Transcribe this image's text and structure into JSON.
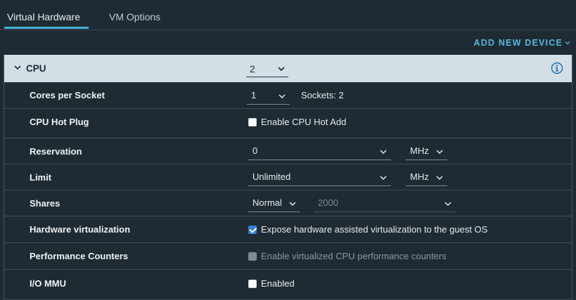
{
  "tabs": [
    {
      "label": "Virtual Hardware",
      "active": true
    },
    {
      "label": "VM Options",
      "active": false
    }
  ],
  "toolbar": {
    "add_device_label": "ADD NEW DEVICE"
  },
  "cpu": {
    "title": "CPU",
    "value": "2",
    "info_icon": "info-circle-icon",
    "rows": {
      "cores": {
        "label": "Cores per Socket",
        "value": "1",
        "sockets_text": "Sockets: 2"
      },
      "hotplug": {
        "label": "CPU Hot Plug",
        "checkbox_label": "Enable CPU Hot Add",
        "checked": false
      },
      "reservation": {
        "label": "Reservation",
        "value": "0",
        "unit": "MHz"
      },
      "limit": {
        "label": "Limit",
        "value": "Unlimited",
        "unit": "MHz"
      },
      "shares": {
        "label": "Shares",
        "level": "Normal",
        "value": "2000"
      },
      "hwvirt": {
        "label": "Hardware virtualization",
        "checkbox_label": "Expose hardware assisted virtualization to the guest OS",
        "checked": true
      },
      "perfcounters": {
        "label": "Performance Counters",
        "checkbox_label": "Enable virtualized CPU performance counters",
        "checked": false,
        "disabled": true
      },
      "iommu": {
        "label": "I/O MMU",
        "checkbox_label": "Enabled",
        "checked": false
      }
    }
  },
  "colors": {
    "background": "#1f2b33",
    "header_bg": "#d3dee5",
    "accent": "#49afd9",
    "checkbox_checked": "#2f7fd8"
  }
}
